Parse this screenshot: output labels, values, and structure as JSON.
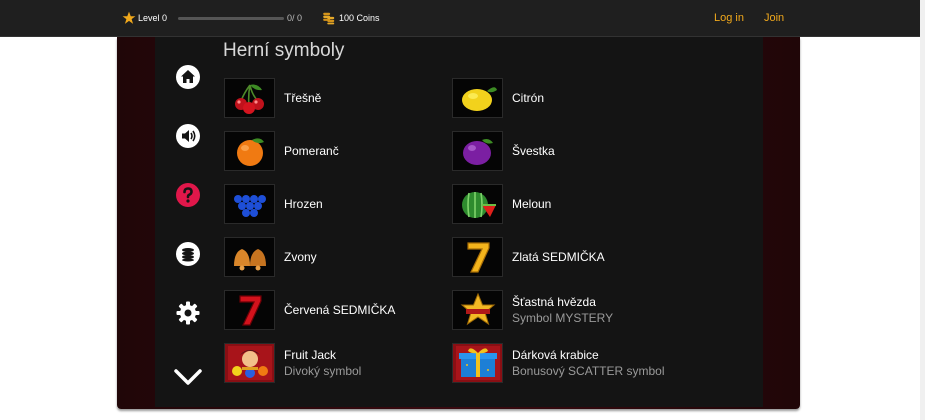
{
  "topbar": {
    "level_label": "Level 0",
    "progress_text": "0/ 0",
    "progress_fraction": 0,
    "coins_label": "100 Coins",
    "login_label": "Log in",
    "join_label": "Join",
    "accent_color": "#f0a81c"
  },
  "sidenav": [
    {
      "icon": "home-icon"
    },
    {
      "icon": "speaker-icon"
    },
    {
      "icon": "help-icon"
    },
    {
      "icon": "coins-icon"
    },
    {
      "icon": "settings-icon"
    },
    {
      "icon": "chevron-down-icon"
    }
  ],
  "panel": {
    "title": "Herní symboly",
    "symbols": [
      {
        "name": "Třešně",
        "sub": "",
        "icon": "cherries-icon"
      },
      {
        "name": "Citrón",
        "sub": "",
        "icon": "lemon-icon"
      },
      {
        "name": "Pomeranč",
        "sub": "",
        "icon": "orange-icon"
      },
      {
        "name": "Švestka",
        "sub": "",
        "icon": "plum-icon"
      },
      {
        "name": "Hrozen",
        "sub": "",
        "icon": "grapes-icon"
      },
      {
        "name": "Meloun",
        "sub": "",
        "icon": "watermelon-icon"
      },
      {
        "name": "Zvony",
        "sub": "",
        "icon": "bells-icon"
      },
      {
        "name": "Zlatá SEDMIČKA",
        "sub": "",
        "icon": "gold-seven-icon"
      },
      {
        "name": "Červená SEDMIČKA",
        "sub": "",
        "icon": "red-seven-icon"
      },
      {
        "name": "Šťastná hvězda",
        "sub": "Symbol MYSTERY",
        "icon": "lucky-star-icon"
      },
      {
        "name": "Fruit Jack",
        "sub": "Divoký symbol",
        "icon": "fruit-jack-icon"
      },
      {
        "name": "Dárková krabice",
        "sub": "Bonusový SCATTER symbol",
        "icon": "gift-box-icon"
      }
    ]
  }
}
